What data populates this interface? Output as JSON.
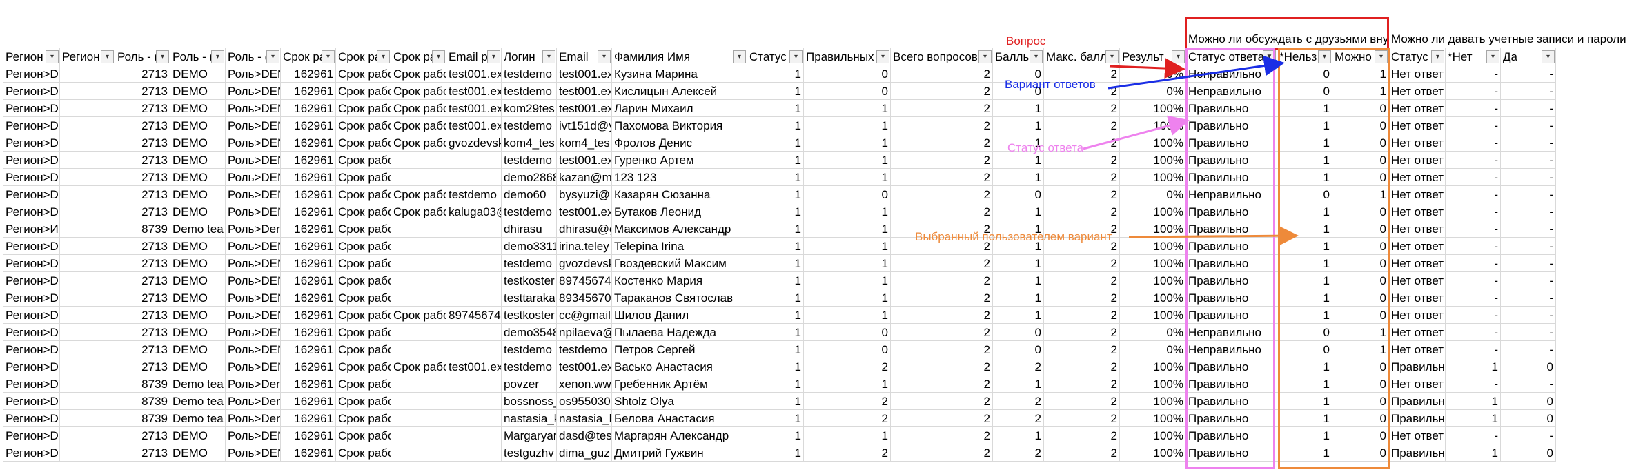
{
  "top_headers": {
    "q1": "Можно ли обсуждать с друзьями вну",
    "q2": "Можно ли давать учетные записи и пароли"
  },
  "columns": [
    "Регион",
    "Регион",
    "Роль - (",
    "Роль - (",
    "Роль - (",
    "Срок ра",
    "Срок ра",
    "Срок ра",
    "Email p",
    "Логин",
    "Email",
    "Фамилия Имя",
    "Статус",
    "Правильных",
    "Всего вопросов",
    "Баллы",
    "Макс. балл",
    "Результ",
    "Статус ответа",
    "*Нельз",
    "Можно",
    "Статус",
    "*Нет",
    "Да"
  ],
  "rows": [
    [
      "Регион>DEMO>DEM",
      "",
      "2713",
      "DEMO",
      "Роль>DEN",
      "162961",
      "Срок рабо",
      "Срок рабо",
      "test001.ex",
      "testdemo",
      "test001.ex",
      "Кузина Марина",
      "1",
      "0",
      "2",
      "0",
      "2",
      "0%",
      "Неправильно",
      "0",
      "1",
      "Нет ответ",
      "-",
      "-"
    ],
    [
      "Регион>DEMO>DEM",
      "",
      "2713",
      "DEMO",
      "Роль>DEN",
      "162961",
      "Срок рабо",
      "Срок рабо",
      "test001.ex",
      "testdemo",
      "test001.ex",
      "Кислицын Алексей",
      "1",
      "0",
      "2",
      "0",
      "2",
      "0%",
      "Неправильно",
      "0",
      "1",
      "Нет ответ",
      "-",
      "-"
    ],
    [
      "Регион>DEMO>DEM",
      "",
      "2713",
      "DEMO",
      "Роль>DEN",
      "162961",
      "Срок рабо",
      "Срок рабо",
      "test001.ex",
      "kom29tes",
      "test001.ex",
      "Ларин Михаил",
      "1",
      "1",
      "2",
      "1",
      "2",
      "100%",
      "Правильно",
      "1",
      "0",
      "Нет ответ",
      "-",
      "-"
    ],
    [
      "Регион>DEMO>DEM",
      "",
      "2713",
      "DEMO",
      "Роль>DEN",
      "162961",
      "Срок рабо",
      "Срок рабо",
      "test001.ex",
      "testdemo",
      "ivt151d@y",
      "Пахомова Виктория",
      "1",
      "1",
      "2",
      "1",
      "2",
      "100%",
      "Правильно",
      "1",
      "0",
      "Нет ответ",
      "-",
      "-"
    ],
    [
      "Регион>DEMO>DEM",
      "",
      "2713",
      "DEMO",
      "Роль>DEN",
      "162961",
      "Срок рабо",
      "Срок рабо",
      "gvozdevsk",
      "kom4_tes",
      "kom4_tes",
      "Фролов Денис",
      "1",
      "1",
      "2",
      "1",
      "2",
      "100%",
      "Правильно",
      "1",
      "0",
      "Нет ответ",
      "-",
      "-"
    ],
    [
      "Регион>DEMO>DEM",
      "",
      "2713",
      "DEMO",
      "Роль>DEN",
      "162961",
      "Срок работы",
      "",
      "",
      "testdemo",
      "test001.ex",
      "Гуренко Артем",
      "1",
      "1",
      "2",
      "1",
      "2",
      "100%",
      "Правильно",
      "1",
      "0",
      "Нет ответ",
      "-",
      "-"
    ],
    [
      "Регион>DEMO>DEM",
      "",
      "2713",
      "DEMO",
      "Роль>DEN",
      "162961",
      "Срок работы",
      "",
      "",
      "demo2868",
      "kazan@m",
      "123 123",
      "1",
      "1",
      "2",
      "1",
      "2",
      "100%",
      "Правильно",
      "1",
      "0",
      "Нет ответ",
      "-",
      "-"
    ],
    [
      "Регион>DEMO>DEM",
      "",
      "2713",
      "DEMO",
      "Роль>DEN",
      "162961",
      "Срок рабо",
      "Срок рабо",
      "testdemo",
      "demo60",
      "bysyuzi@",
      "Казарян Сюзанна",
      "1",
      "0",
      "2",
      "0",
      "2",
      "0%",
      "Неправильно",
      "0",
      "1",
      "Нет ответ",
      "-",
      "-"
    ],
    [
      "Регион>DEMO>DEM",
      "",
      "2713",
      "DEMO",
      "Роль>DEN",
      "162961",
      "Срок рабо",
      "Срок рабо",
      "kaluga03@",
      "testdemo",
      "test001.ex",
      "Бутаков Леонид",
      "1",
      "1",
      "2",
      "1",
      "2",
      "100%",
      "Правильно",
      "1",
      "0",
      "Нет ответ",
      "-",
      "-"
    ],
    [
      "Регион>Индивидуа.",
      "",
      "8739",
      "Demo tea",
      "Роль>Den",
      "162961",
      "Срок работы",
      "",
      "",
      "dhirasu",
      "dhirasu@g",
      "Максимов Александр",
      "1",
      "1",
      "2",
      "1",
      "2",
      "100%",
      "Правильно",
      "1",
      "0",
      "Нет ответ",
      "-",
      "-"
    ],
    [
      "Регион>DEMO>DEM",
      "",
      "2713",
      "DEMO",
      "Роль>DEN",
      "162961",
      "Срок работы",
      "",
      "",
      "demo3311",
      "irina.teley",
      "Telepina Irina",
      "1",
      "1",
      "2",
      "1",
      "2",
      "100%",
      "Правильно",
      "1",
      "0",
      "Нет ответ",
      "-",
      "-"
    ],
    [
      "Регион>DEMO>DEM",
      "",
      "2713",
      "DEMO",
      "Роль>DEN",
      "162961",
      "Срок работы",
      "",
      "",
      "testdemo",
      "gvozdevsk",
      "Гвоздевский Максим",
      "1",
      "1",
      "2",
      "1",
      "2",
      "100%",
      "Правильно",
      "1",
      "0",
      "Нет ответ",
      "-",
      "-"
    ],
    [
      "Регион>DEMO>DEM",
      "",
      "2713",
      "DEMO",
      "Роль>DEN",
      "162961",
      "Срок работы",
      "",
      "",
      "testkoster",
      "897456743",
      "Костенко Мария",
      "1",
      "1",
      "2",
      "1",
      "2",
      "100%",
      "Правильно",
      "1",
      "0",
      "Нет ответ",
      "-",
      "-"
    ],
    [
      "Регион>DEMO>DEM",
      "",
      "2713",
      "DEMO",
      "Роль>DEN",
      "162961",
      "Срок работы",
      "",
      "",
      "testtaraka",
      "893456709",
      "Тараканов Святослав",
      "1",
      "1",
      "2",
      "1",
      "2",
      "100%",
      "Правильно",
      "1",
      "0",
      "Нет ответ",
      "-",
      "-"
    ],
    [
      "Регион>DEMO>DEM",
      "",
      "2713",
      "DEMO",
      "Роль>DEN",
      "162961",
      "Срок рабо",
      "Срок рабо",
      "897456743",
      "testkoster",
      "cc@gmail.",
      "Шилов Данил",
      "1",
      "1",
      "2",
      "1",
      "2",
      "100%",
      "Правильно",
      "1",
      "0",
      "Нет ответ",
      "-",
      "-"
    ],
    [
      "Регион>DEMO>DEM",
      "",
      "2713",
      "DEMO",
      "Роль>DEN",
      "162961",
      "Срок работы",
      "",
      "",
      "demo3548",
      "npilaeva@",
      "Пылаева Надежда",
      "1",
      "0",
      "2",
      "0",
      "2",
      "0%",
      "Неправильно",
      "0",
      "1",
      "Нет ответ",
      "-",
      "-"
    ],
    [
      "Регион>DEMO>DEM",
      "",
      "2713",
      "DEMO",
      "Роль>DEN",
      "162961",
      "Срок работы",
      "",
      "",
      "testdemo",
      "testdemo",
      "Петров Сергей",
      "1",
      "0",
      "2",
      "0",
      "2",
      "0%",
      "Неправильно",
      "0",
      "1",
      "Нет ответ",
      "-",
      "-"
    ],
    [
      "Регион>DEMO>DEM",
      "",
      "2713",
      "DEMO",
      "Роль>DEN",
      "162961",
      "Срок рабо",
      "Срок рабо",
      "test001.ex",
      "testdemo",
      "test001.ex",
      "Васько Анастасия",
      "1",
      "2",
      "2",
      "2",
      "2",
      "100%",
      "Правильно",
      "1",
      "0",
      "Правильн",
      "1",
      "0"
    ],
    [
      "Регион>Demo regio",
      "",
      "8739",
      "Demo tea",
      "Роль>Den",
      "162961",
      "Срок работы",
      "",
      "",
      "povzer",
      "xenon.ww",
      "Гребенник Артём",
      "1",
      "1",
      "2",
      "1",
      "2",
      "100%",
      "Правильно",
      "1",
      "0",
      "Нет ответ",
      "-",
      "-"
    ],
    [
      "Регион>Demo regio",
      "",
      "8739",
      "Demo tea",
      "Роль>Den",
      "162961",
      "Срок работы",
      "",
      "",
      "bossnoss_",
      "os955030(",
      "Shtolz Olya",
      "1",
      "2",
      "2",
      "2",
      "2",
      "100%",
      "Правильно",
      "1",
      "0",
      "Правильн",
      "1",
      "0"
    ],
    [
      "Регион>Demo regio",
      "",
      "8739",
      "Demo tea",
      "Роль>Den",
      "162961",
      "Срок работы",
      "",
      "",
      "nastasia_k",
      "nastasia_k",
      "Белова Анастасия",
      "1",
      "2",
      "2",
      "2",
      "2",
      "100%",
      "Правильно",
      "1",
      "0",
      "Правильн",
      "1",
      "0"
    ],
    [
      "Регион>DEMO>DEM",
      "",
      "2713",
      "DEMO",
      "Роль>DEN",
      "162961",
      "Срок работы",
      "",
      "",
      "Margaryar",
      "dasd@tes",
      "Маргарян Александр",
      "1",
      "1",
      "2",
      "1",
      "2",
      "100%",
      "Правильно",
      "1",
      "0",
      "Нет ответ",
      "-",
      "-"
    ],
    [
      "Регион>DEMO",
      "",
      "2713",
      "DEMO",
      "Роль>DEN",
      "162961",
      "Срок работы",
      "",
      "",
      "testguzhv",
      "dima_guz",
      "Дмитрий Гужвин",
      "1",
      "2",
      "2",
      "2",
      "2",
      "100%",
      "Правильно",
      "1",
      "0",
      "Правильн",
      "1",
      "0"
    ]
  ],
  "annotations": {
    "question": "Вопрос",
    "options": "Вариант ответов",
    "answer_status": "Статус ответа",
    "selected_option": "Выбранный пользователем вариант"
  },
  "colors": {
    "red": "#e02020",
    "blue": "#1a2ee6",
    "pink": "#ee82ee",
    "orange": "#ee8a3a",
    "grid": "#d9d9d9"
  }
}
